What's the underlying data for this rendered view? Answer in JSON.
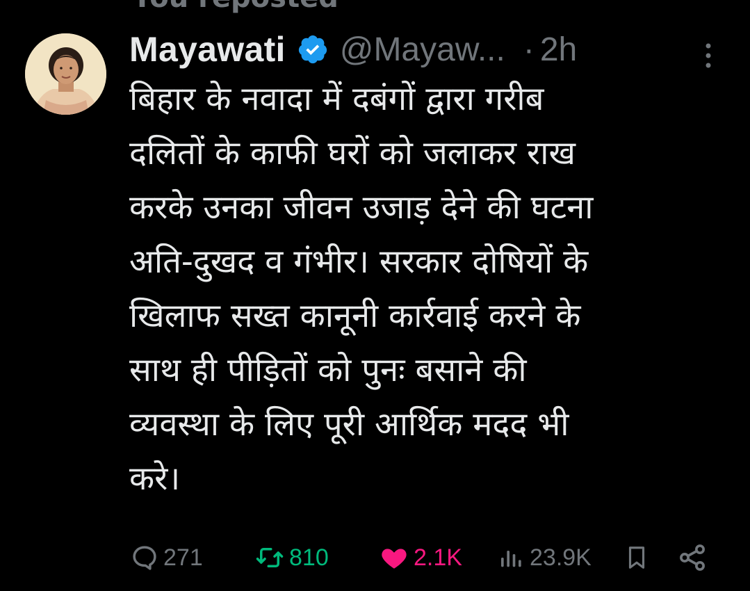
{
  "repost_header": "You reposted",
  "author": {
    "display_name": "Mayawati",
    "handle": "@Mayaw...",
    "separator": "·",
    "time": "2h"
  },
  "tweet": {
    "lines": [
      "बिहार के नवादा में दबंगों द्वारा गरीब",
      "दलितों के काफी घरों को जलाकर राख",
      "करके उनका जीवन उजाड़ देने की घटना",
      "अति-दुखद व गंभीर। सरकार दोषियों के",
      "खिलाफ सख्त कानूनी कार्रवाई करने के",
      "साथ ही पीड़ितों को पुनः बसाने की",
      "व्यवस्था के लिए पूरी आर्थिक मदद भी",
      "करे।"
    ]
  },
  "actions": {
    "replies": "271",
    "reposts": "810",
    "likes": "2.1K",
    "views": "23.9K"
  },
  "icons": {
    "verified": "verified-badge-icon",
    "more": "more-vertical-icon",
    "reply": "reply-icon",
    "repost": "repost-icon",
    "like": "heart-icon",
    "views": "views-icon",
    "bookmark": "bookmark-icon",
    "share": "share-icon"
  },
  "colors": {
    "background": "#000000",
    "text": "#e7e9ea",
    "muted": "#71767b",
    "verified": "#1d9bf0",
    "repost_active": "#00ba7c",
    "like_active": "#f91880"
  }
}
